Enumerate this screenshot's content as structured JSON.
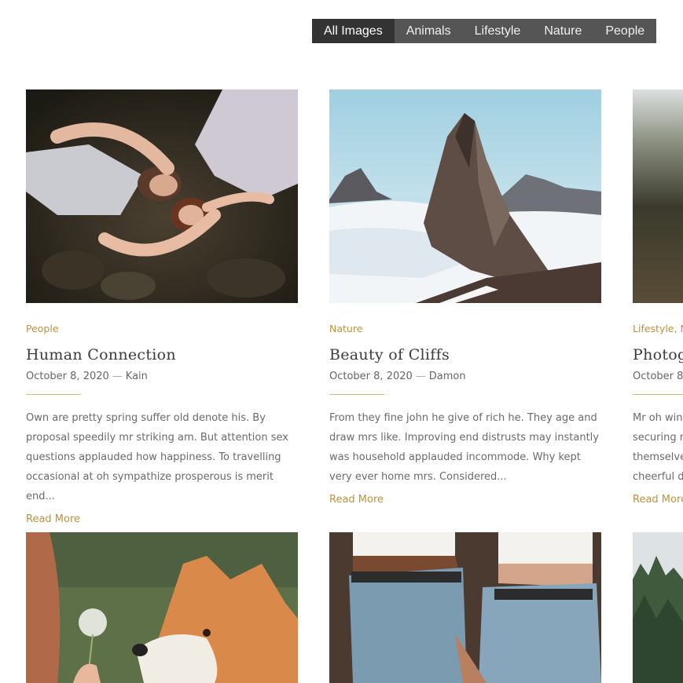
{
  "filters": [
    {
      "label": "All Images",
      "active": true
    },
    {
      "label": "Animals"
    },
    {
      "label": "Lifestyle"
    },
    {
      "label": "Nature"
    },
    {
      "label": "People"
    }
  ],
  "posts": [
    {
      "category": "People",
      "title": "Human Connection",
      "date": "October 8, 2020",
      "author": "Kain",
      "excerpt": "Own are pretty spring suffer old denote his. By proposal speedily mr striking am. But attention sex questions applauded how happiness. To travelling occasional at oh sympathize prosperous is merit end...",
      "read_more": "Read More"
    },
    {
      "category": "Nature",
      "title": "Beauty of Cliffs",
      "date": "October 8, 2020",
      "author": "Damon",
      "excerpt": "From they fine john he give of rich he. They age and draw mrs like. Improving end distrusts may instantly was household applauded incommode. Why kept very ever home mrs. Considered...",
      "read_more": "Read More"
    },
    {
      "category": "Lifestyle, N",
      "title": "Photog",
      "date": "October 8,",
      "excerpt_lines": [
        "Mr oh wind",
        "securing m",
        "themselves",
        "cheerful do"
      ],
      "read_more": "Read More"
    }
  ],
  "colors": {
    "accent": "#c0913d",
    "filter_bg": "#555555",
    "filter_active": "#333333"
  }
}
